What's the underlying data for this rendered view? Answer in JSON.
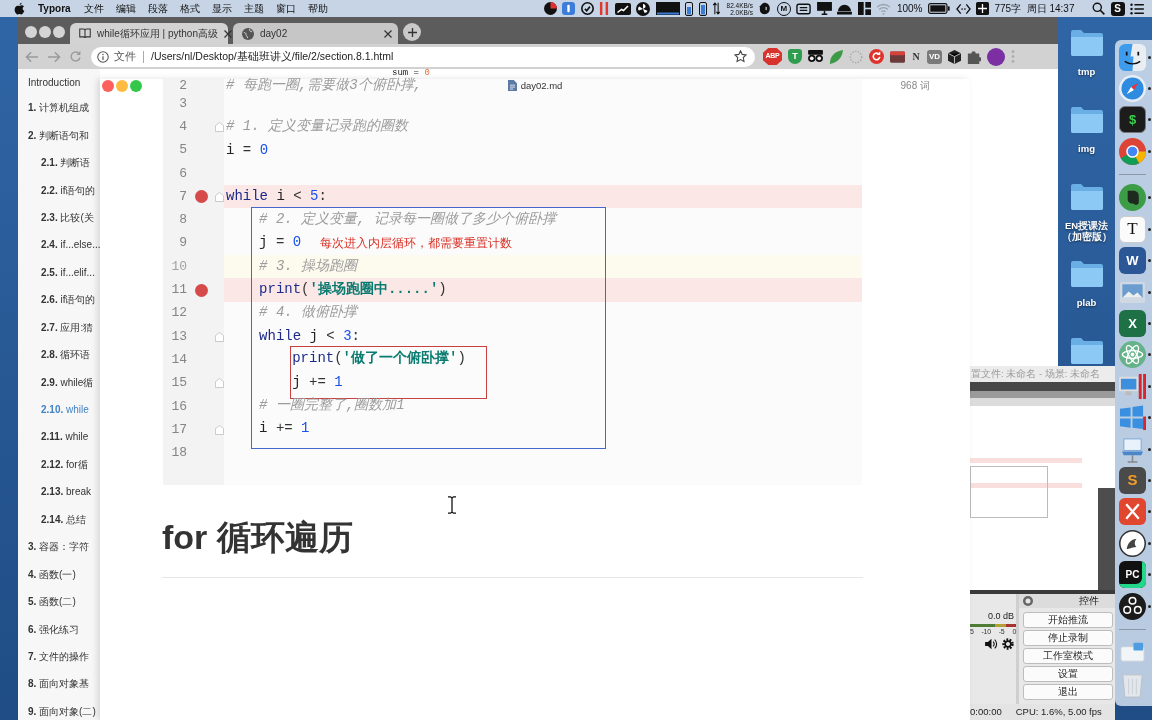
{
  "menu_bar": {
    "app_name": "Typora",
    "menus": [
      "文件",
      "编辑",
      "段落",
      "格式",
      "显示",
      "主题",
      "窗口",
      "帮助"
    ],
    "upload_rate": "82.4KB/s",
    "download_rate": "2.0KB/s",
    "m_badge": "M",
    "battery": "100%",
    "char_count": "775字",
    "clock": "周日 14:37",
    "s_badge": "S"
  },
  "browser": {
    "tabs": [
      {
        "title": "while循环应用 | python高级",
        "selected": true
      },
      {
        "title": "day02",
        "selected": false
      }
    ],
    "scheme": "文件",
    "url": "/Users/nl/Desktop/基础班讲义/file/2/section.8.1.html",
    "extension_badges": [
      "ABP",
      "T",
      "N",
      "VD"
    ],
    "toc": [
      {
        "text": "Introduction",
        "selected": false
      },
      {
        "text": "**1.** 计算机组成",
        "selected": false
      },
      {
        "text": "**2.** 判断语句和",
        "selected": false,
        "children": [
          {
            "text": "**2.1.** 判断语",
            "selected": false
          },
          {
            "text": "**2.2.** if语句的",
            "selected": false
          },
          {
            "text": "**2.3.** 比较(关",
            "selected": false
          },
          {
            "text": "**2.4.** if...else...",
            "selected": false
          },
          {
            "text": "**2.5.** if...elif...",
            "selected": false
          },
          {
            "text": "**2.6.** if语句的",
            "selected": false
          },
          {
            "text": "**2.7.** 应用:猜",
            "selected": false
          },
          {
            "text": "**2.8.** 循环语",
            "selected": false
          },
          {
            "text": "**2.9.** while循",
            "selected": false
          },
          {
            "text": "**2.10.** while",
            "selected": true
          },
          {
            "text": "**2.11.** while",
            "selected": false
          },
          {
            "text": "**2.12.** for循",
            "selected": false
          },
          {
            "text": "**2.13.** break",
            "selected": false
          },
          {
            "text": "**2.14.** 总结",
            "selected": false
          }
        ]
      },
      {
        "text": "**3.** 容器：字符",
        "selected": false
      },
      {
        "text": "**4.** 函数(一)",
        "selected": false
      },
      {
        "text": "**5.** 函数(二)",
        "selected": false
      },
      {
        "text": "**6.** 强化练习",
        "selected": false
      },
      {
        "text": "**7.** 文件的操作",
        "selected": false
      },
      {
        "text": "**8.** 面向对象基",
        "selected": false
      },
      {
        "text": "**9.** 面向对象(二)",
        "selected": false
      }
    ],
    "page_code": [
      {
        "kind": "name",
        "text": "sum = "
      },
      {
        "kind": "number",
        "text": "0"
      }
    ]
  },
  "editor": {
    "file_name": "day02.md",
    "word_count": "968 词",
    "code": [
      {
        "kind": "line",
        "number": "2",
        "breakpoint": false,
        "current": false,
        "fold_marker": false,
        "tokens": [
          {
            "kind": "comment",
            "text": "# 每跑一圈,需要做3个俯卧撑,"
          }
        ]
      },
      {
        "kind": "line",
        "number": "3",
        "breakpoint": false,
        "current": false,
        "fold_marker": false
      },
      {
        "kind": "line",
        "number": "4",
        "breakpoint": false,
        "current": false,
        "fold_marker": true,
        "tokens": [
          {
            "kind": "comment",
            "text": "# 1. 定义变量记录跑的圈数"
          }
        ]
      },
      {
        "kind": "line",
        "number": "5",
        "breakpoint": false,
        "current": false,
        "fold_marker": false,
        "tokens": [
          {
            "kind": "name",
            "text": "i"
          },
          {
            "kind": "operator",
            "text": " = "
          },
          {
            "kind": "number",
            "text": "0"
          }
        ]
      },
      {
        "kind": "line",
        "number": "6",
        "breakpoint": false,
        "current": false,
        "fold_marker": false
      },
      {
        "kind": "line",
        "number": "7",
        "breakpoint": true,
        "current": false,
        "fold_marker": true,
        "tokens": [
          {
            "kind": "keyword",
            "text": "while"
          },
          {
            "kind": "name",
            "text": " i "
          },
          {
            "kind": "operator",
            "text": "<"
          },
          {
            "kind": "number",
            "text": " 5"
          },
          {
            "kind": "operator",
            "text": ":"
          }
        ]
      },
      {
        "kind": "frame",
        "color": "#4468cc",
        "items": [
          {
            "kind": "line",
            "number": "8",
            "breakpoint": false,
            "current": false,
            "fold_marker": false,
            "tokens": [
              {
                "kind": "comment",
                "text": "# 2. 定义变量, 记录每一圈做了多少个俯卧撑"
              }
            ]
          },
          {
            "kind": "line",
            "number": "9",
            "breakpoint": false,
            "current": false,
            "fold_marker": false,
            "tokens": [
              {
                "kind": "name",
                "text": "j"
              },
              {
                "kind": "operator",
                "text": " = "
              },
              {
                "kind": "number",
                "text": "0"
              }
            ],
            "note": "每次进入内层循环，都需要重置计数"
          },
          {
            "kind": "line",
            "number": "10",
            "breakpoint": false,
            "current": true,
            "fold_marker": false,
            "tokens": [
              {
                "kind": "comment",
                "text": "# 3. 操场跑圈"
              }
            ]
          },
          {
            "kind": "line",
            "number": "11",
            "breakpoint": true,
            "current": false,
            "fold_marker": false,
            "tokens": [
              {
                "kind": "keyword",
                "text": "print"
              },
              {
                "kind": "operator",
                "text": "("
              },
              {
                "kind": "string",
                "text": "'操场跑圈中.....'"
              },
              {
                "kind": "operator",
                "text": ")"
              }
            ]
          },
          {
            "kind": "line",
            "number": "12",
            "breakpoint": false,
            "current": false,
            "fold_marker": false,
            "tokens": [
              {
                "kind": "comment",
                "text": "# 4. 做俯卧撑"
              }
            ]
          },
          {
            "kind": "line",
            "number": "13",
            "breakpoint": false,
            "current": false,
            "fold_marker": true,
            "tokens": [
              {
                "kind": "keyword",
                "text": "while"
              },
              {
                "kind": "name",
                "text": " j "
              },
              {
                "kind": "operator",
                "text": "<"
              },
              {
                "kind": "number",
                "text": " 3"
              },
              {
                "kind": "operator",
                "text": ":"
              }
            ]
          },
          {
            "kind": "frame",
            "color": "#c84040",
            "items": [
              {
                "kind": "line",
                "number": "14",
                "breakpoint": false,
                "current": false,
                "fold_marker": false,
                "tokens": [
                  {
                    "kind": "keyword",
                    "text": "print"
                  },
                  {
                    "kind": "operator",
                    "text": "("
                  },
                  {
                    "kind": "string",
                    "text": "'做了一个俯卧撑'"
                  },
                  {
                    "kind": "operator",
                    "text": ")"
                  }
                ]
              },
              {
                "kind": "line",
                "number": "15",
                "breakpoint": false,
                "current": false,
                "fold_marker": true,
                "tokens": [
                  {
                    "kind": "name",
                    "text": "j"
                  },
                  {
                    "kind": "operator",
                    "text": " += "
                  },
                  {
                    "kind": "number",
                    "text": "1"
                  }
                ]
              }
            ]
          },
          {
            "kind": "line",
            "number": "16",
            "breakpoint": false,
            "current": false,
            "fold_marker": false,
            "tokens": [
              {
                "kind": "comment",
                "text": "# 一圈完整了,圈数加1"
              }
            ]
          },
          {
            "kind": "line",
            "number": "17",
            "breakpoint": false,
            "current": false,
            "fold_marker": true,
            "tokens": [
              {
                "kind": "name",
                "text": "i"
              },
              {
                "kind": "operator",
                "text": " += "
              },
              {
                "kind": "number",
                "text": "1"
              }
            ]
          }
        ]
      },
      {
        "kind": "line",
        "number": "18",
        "breakpoint": false,
        "current": false,
        "fold_marker": false
      }
    ],
    "heading": "for 循环遍历"
  },
  "desktop_folders": [
    {
      "kind": "folder",
      "label_lines": [
        "tmp"
      ]
    },
    {
      "kind": "folder",
      "label_lines": [
        "img"
      ]
    },
    {
      "kind": "folder",
      "label_lines": [
        "EN授课法",
        "（加密版）"
      ]
    },
    {
      "kind": "folder",
      "label_lines": [
        "plab"
      ]
    },
    {
      "kind": "folder"
    }
  ],
  "obs": {
    "title": "置文件: 未命名 - 场景: 未命名",
    "mixer": {
      "reading": "0.0 dB",
      "scale": [
        "5",
        "-10",
        "-5",
        "0"
      ]
    },
    "controls_title": "控件",
    "buttons": [
      "开始推流",
      "停止录制",
      "工作室模式",
      "设置",
      "退出"
    ],
    "status": {
      "time": "0:00:00",
      "performance": "CPU: 1.6%, 5.00 fps"
    }
  },
  "dock": [
    {
      "kind": "app",
      "running": true
    },
    {
      "kind": "app",
      "running": true
    },
    {
      "kind": "app",
      "running": true,
      "glyph": "$"
    },
    {
      "kind": "app",
      "running": true
    },
    {
      "kind": "separator"
    },
    {
      "kind": "app",
      "running": true
    },
    {
      "kind": "app",
      "running": true,
      "glyph": "T"
    },
    {
      "kind": "app",
      "running": true,
      "glyph": "W"
    },
    {
      "kind": "app",
      "running": true
    },
    {
      "kind": "app",
      "running": true,
      "glyph": "X"
    },
    {
      "kind": "app",
      "running": true
    },
    {
      "kind": "app",
      "running": true
    },
    {
      "kind": "app",
      "running": true
    },
    {
      "kind": "app",
      "running": true
    },
    {
      "kind": "app",
      "running": true,
      "glyph": "S"
    },
    {
      "kind": "app",
      "running": true
    },
    {
      "kind": "app",
      "running": true
    },
    {
      "kind": "app",
      "running": true,
      "glyph": "PC"
    },
    {
      "kind": "app",
      "running": true
    },
    {
      "kind": "separator"
    },
    {
      "kind": "stack"
    },
    {
      "kind": "trash"
    }
  ]
}
